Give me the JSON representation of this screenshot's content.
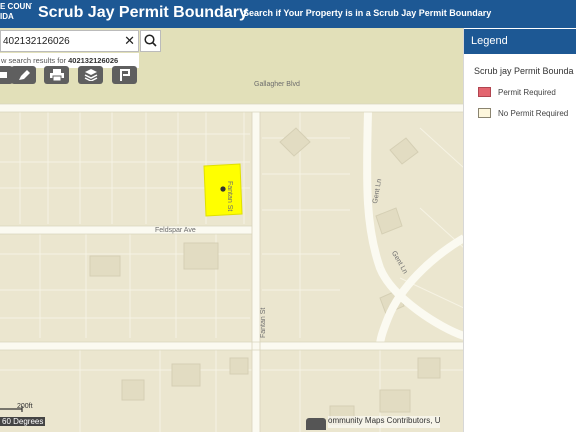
{
  "header": {
    "logo_line1": "E COUNTY",
    "logo_line2": "IDA",
    "title": "Scrub Jay Permit Boundary",
    "tagline": "Search if Your Property is in a Scrub Jay Permit Boundary"
  },
  "search": {
    "value": "402132126026",
    "clear_glyph": "✕",
    "suggestion_prefix": "w search results for ",
    "suggestion_query": "402132126026"
  },
  "toolbar": {
    "icons": [
      "ruler-icon",
      "edit-icon",
      "print-icon",
      "layers-icon",
      "bookmark-icon"
    ]
  },
  "map": {
    "road_labels": {
      "gallagher": "Gallagher Blvd",
      "feldspar": "Feldspar Ave",
      "fantan_north": "Fantan St",
      "fantan_south": "Fantan St",
      "gent_north": "Gent Ln",
      "gent_south": "Gent Ln"
    },
    "scale_text": "200ft",
    "rotation_text": "60 Degrees",
    "attribution": "ommunity Maps Contributors, U",
    "colors": {
      "parcel": "#ffff00",
      "road": "#fbfaf1",
      "land": "#ebe6cf",
      "park": "#e2e0b9"
    }
  },
  "legend": {
    "title": "Legend",
    "subtitle": "Scrub jay Permit Bounda",
    "items": [
      {
        "label": "Permit Required",
        "color": "#e3656f"
      },
      {
        "label": "No Permit Required",
        "color": "#fdf6dc"
      }
    ]
  }
}
